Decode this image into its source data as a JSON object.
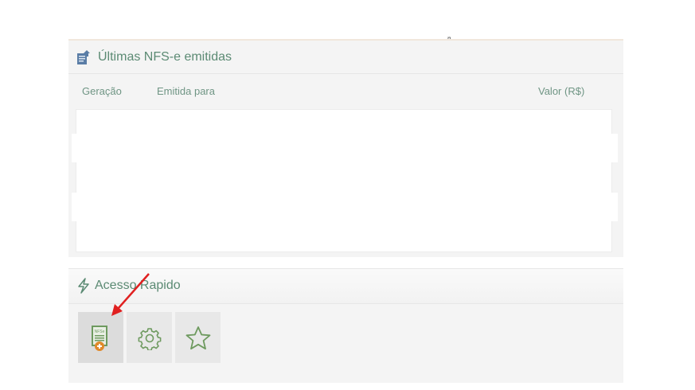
{
  "nfse_panel": {
    "title": "Últimas NFS-e emitidas",
    "icon": "document-upload-icon",
    "columns": [
      "Geração",
      "Emitida para",
      "Valor (R$)"
    ]
  },
  "acesso_panel": {
    "title": "Acesso Rapido",
    "icon": "lightning-icon",
    "buttons": [
      {
        "icon": "nfse-add-icon",
        "icon_text": "NFSe"
      },
      {
        "icon": "gear-icon"
      },
      {
        "icon": "star-icon"
      }
    ]
  },
  "colors": {
    "accent": "#5b8a73",
    "icon_green": "#6e9a5f",
    "badge_orange": "#e0892a",
    "annotation_arrow": "#e02020"
  }
}
